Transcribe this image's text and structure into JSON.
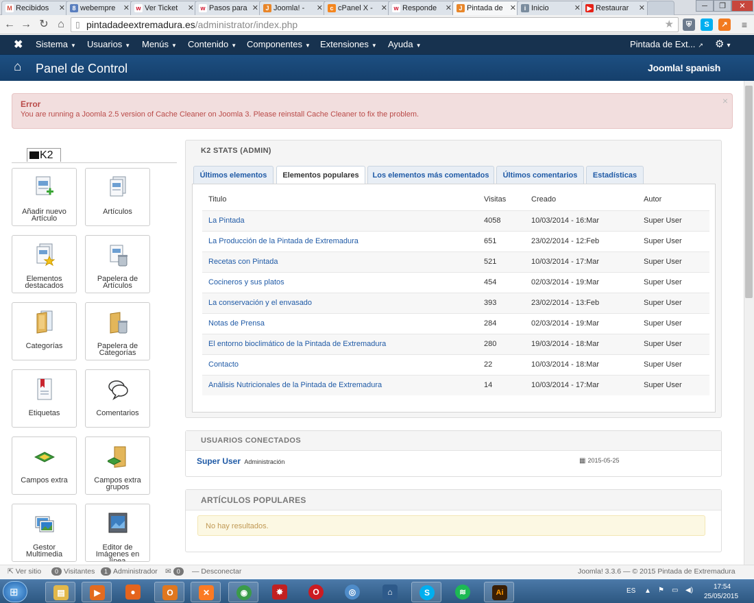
{
  "browser": {
    "tabs": [
      {
        "label": "Recibidos",
        "icon": "gmail-icon",
        "color": "#d44638",
        "glyph": "M"
      },
      {
        "label": "webempre",
        "icon": "google-plus-icon",
        "color": "#5a7fbf",
        "glyph": "8"
      },
      {
        "label": "Ver Ticket",
        "icon": "webempresa-icon",
        "color": "#d0112b",
        "glyph": "w"
      },
      {
        "label": "Pasos para",
        "icon": "webempresa-icon",
        "color": "#d0112b",
        "glyph": "w"
      },
      {
        "label": "Joomla! -",
        "icon": "joomla-icon",
        "color": "#e8862a",
        "glyph": "J"
      },
      {
        "label": "cPanel X -",
        "icon": "cpanel-icon",
        "color": "#f4861f",
        "glyph": "c"
      },
      {
        "label": "Responde",
        "icon": "webempresa-icon",
        "color": "#d0112b",
        "glyph": "w"
      },
      {
        "label": "Pintada de",
        "icon": "joomla-icon",
        "color": "#e8862a",
        "glyph": "J"
      },
      {
        "label": "Inicio",
        "icon": "page-icon",
        "color": "#7a8c9e",
        "glyph": "i"
      },
      {
        "label": "Restaurar",
        "icon": "youtube-icon",
        "color": "#e62117",
        "glyph": "▶"
      }
    ],
    "url_host": "pintadadeextremadura.es",
    "url_path": "/administrator/index.php"
  },
  "jnav": {
    "menus": [
      "Sistema",
      "Usuarios",
      "Menús",
      "Contenido",
      "Componentes",
      "Extensiones",
      "Ayuda"
    ],
    "site_link": "Pintada de Ext...",
    "gear_caret": "▾"
  },
  "header": {
    "title": "Panel de Control",
    "logo": "Joomla! spanish"
  },
  "error": {
    "heading": "Error",
    "message": "You are running a Joomla 2.5 version of Cache Cleaner on Joomla 3. Please reinstall Cache Cleaner to fix the problem."
  },
  "k2": {
    "logo": "K2",
    "buttons": [
      {
        "label": "Añadir nuevo Artículo",
        "icon": "add-article-icon"
      },
      {
        "label": "Artículos",
        "icon": "articles-icon"
      },
      {
        "label": "Elementos destacados",
        "icon": "featured-items-icon"
      },
      {
        "label": "Papelera de Artículos",
        "icon": "trash-articles-icon"
      },
      {
        "label": "Categorías",
        "icon": "categories-icon"
      },
      {
        "label": "Papelera de Categorías",
        "icon": "trash-categories-icon"
      },
      {
        "label": "Etiquetas",
        "icon": "tags-icon"
      },
      {
        "label": "Comentarios",
        "icon": "comments-icon"
      },
      {
        "label": "Campos extra",
        "icon": "extra-fields-icon"
      },
      {
        "label": "Campos extra grupos",
        "icon": "extra-field-groups-icon"
      },
      {
        "label": "Gestor Multimedia",
        "icon": "media-manager-icon"
      },
      {
        "label": "Editor de Imágenes en línea",
        "icon": "image-editor-icon"
      }
    ]
  },
  "stats": {
    "title": "K2 STATS (ADMIN)",
    "tabs": [
      "Últimos elementos",
      "Elementos populares",
      "Los elementos más comentados",
      "Últimos comentarios",
      "Estadísticas"
    ],
    "active_tab": "Elementos populares",
    "columns": [
      "Titulo",
      "Visitas",
      "Creado",
      "Autor"
    ],
    "rows": [
      {
        "title": "La Pintada",
        "visits": "4058",
        "created": "10/03/2014 - 16:Mar",
        "author": "Super User"
      },
      {
        "title": "La Producción de la Pintada de Extremadura",
        "visits": "651",
        "created": "23/02/2014 - 12:Feb",
        "author": "Super User"
      },
      {
        "title": "Recetas con Pintada",
        "visits": "521",
        "created": "10/03/2014 - 17:Mar",
        "author": "Super User"
      },
      {
        "title": "Cocineros y sus platos",
        "visits": "454",
        "created": "02/03/2014 - 19:Mar",
        "author": "Super User"
      },
      {
        "title": "La conservación y el envasado",
        "visits": "393",
        "created": "23/02/2014 - 13:Feb",
        "author": "Super User"
      },
      {
        "title": "Notas de Prensa",
        "visits": "284",
        "created": "02/03/2014 - 19:Mar",
        "author": "Super User"
      },
      {
        "title": "El entorno bioclimático de la Pintada de Extremadura",
        "visits": "280",
        "created": "19/03/2014 - 18:Mar",
        "author": "Super User"
      },
      {
        "title": "Contacto",
        "visits": "22",
        "created": "10/03/2014 - 18:Mar",
        "author": "Super User"
      },
      {
        "title": "Análisis Nutricionales de la Pintada de Extremadura",
        "visits": "14",
        "created": "10/03/2014 - 17:Mar",
        "author": "Super User"
      }
    ]
  },
  "users_panel": {
    "title": "USUARIOS CONECTADOS",
    "user": "Super User",
    "role": "Administración",
    "date": "2015-05-25"
  },
  "popular_panel": {
    "title": "ARTÍCULOS POPULARES",
    "empty": "No hay resultados."
  },
  "statusbar": {
    "view_site": "Ver sitio",
    "visitors_count": "0",
    "visitors_label": "Visitantes",
    "admin_count": "1",
    "admin_label": "Administrador",
    "messages_count": "0",
    "logout": "Desconectar",
    "version": "Joomla! 3.3.6",
    "copyright": "— © 2015 Pintada de Extremadura"
  },
  "taskbar": {
    "apps": [
      {
        "icon": "file-explorer-icon",
        "color": "#e2b84a",
        "glyph": "▤"
      },
      {
        "icon": "media-player-icon",
        "color": "#e36b1f",
        "glyph": "▶"
      },
      {
        "icon": "firefox-icon",
        "color": "#e5641d",
        "glyph": "●"
      },
      {
        "icon": "outlook-icon",
        "color": "#e0771f",
        "glyph": "O"
      },
      {
        "icon": "xampp-icon",
        "color": "#fb7a24",
        "glyph": "✕"
      },
      {
        "icon": "chrome-icon",
        "color": "#3b9b4a",
        "glyph": "◉"
      },
      {
        "icon": "filezilla-icon",
        "color": "#c22020",
        "glyph": "✸"
      },
      {
        "icon": "opera-icon",
        "color": "#cc1b22",
        "glyph": "O"
      },
      {
        "icon": "safari-icon",
        "color": "#4f8cc9",
        "glyph": "◎"
      },
      {
        "icon": "network-icon",
        "color": "#2e5a8a",
        "glyph": "⌂"
      },
      {
        "icon": "skype-icon",
        "color": "#00aff0",
        "glyph": "S"
      },
      {
        "icon": "spotify-icon",
        "color": "#1db954",
        "glyph": "≋"
      },
      {
        "icon": "illustrator-icon",
        "color": "#ff7c00",
        "glyph": "Ai"
      }
    ],
    "language": "ES",
    "time": "17:54",
    "date": "25/05/2015"
  }
}
